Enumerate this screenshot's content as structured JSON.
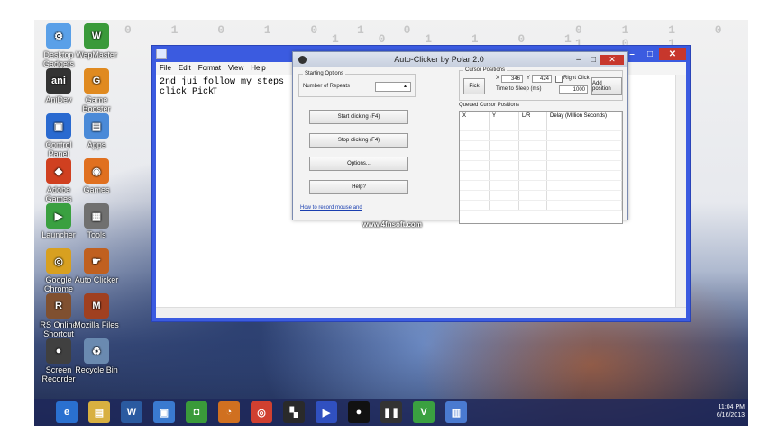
{
  "desktop": {
    "background_digits": [
      "0 1 0 1 0 1 0",
      "1 0 1 1 0 1",
      "0 1 1 0 1 0 1"
    ],
    "icons": [
      {
        "label": "Desktop Gadgets",
        "icon": "gadgets-icon",
        "color": "#5aa0e8",
        "glyph": "⚙"
      },
      {
        "label": "WapMaster",
        "icon": "w-app-icon",
        "color": "#3a9a3a",
        "glyph": "W"
      },
      {
        "label": "AniDev",
        "icon": "ani-icon",
        "color": "#333333",
        "glyph": "ani"
      },
      {
        "label": "Game Booster",
        "icon": "booster-icon",
        "color": "#e08a20",
        "glyph": "G"
      },
      {
        "label": "Control Panel",
        "icon": "control-panel-icon",
        "color": "#2a6ad0",
        "glyph": "▣"
      },
      {
        "label": "Apps",
        "icon": "apps-icon",
        "color": "#4a8ad8",
        "glyph": "▤"
      },
      {
        "label": "Adobe Games",
        "icon": "games-icon",
        "color": "#d04020",
        "glyph": "◆"
      },
      {
        "label": "Games",
        "icon": "games2-icon",
        "color": "#e07020",
        "glyph": "◉"
      },
      {
        "label": "Launcher",
        "icon": "launcher-icon",
        "color": "#3aa040",
        "glyph": "▶"
      },
      {
        "label": "Tools",
        "icon": "tools-icon",
        "color": "#707070",
        "glyph": "▦"
      },
      {
        "label": "Google Chrome",
        "icon": "chrome-icon",
        "color": "#d8a020",
        "glyph": "◎"
      },
      {
        "label": "Auto Clicker",
        "icon": "hand-icon",
        "color": "#c06020",
        "glyph": "☛"
      },
      {
        "label": "RS Online Shortcut",
        "icon": "rs-icon",
        "color": "#805030",
        "glyph": "R"
      },
      {
        "label": "Mozilla Files",
        "icon": "mozilla-icon",
        "color": "#a04020",
        "glyph": "M"
      },
      {
        "label": "Screen Recorder",
        "icon": "recorder-icon",
        "color": "#404040",
        "glyph": "●"
      },
      {
        "label": "Recycle Bin",
        "icon": "recycle-bin-icon",
        "color": "#6a8ab0",
        "glyph": "♻"
      }
    ]
  },
  "notepad": {
    "menu": [
      "File",
      "Edit",
      "Format",
      "View",
      "Help"
    ],
    "text": "2nd jui follow my steps\nclick Pick",
    "controls": {
      "minimize": "–",
      "maximize": "□",
      "close": "✕"
    }
  },
  "autoclicker": {
    "title": "Auto-Clicker by Polar 2.0",
    "controls": {
      "minimize": "–",
      "maximize": "□",
      "close": "✕"
    },
    "starting_options": {
      "caption": "Starting Options",
      "repeats_label": "Number of Repeats",
      "repeats_value": ""
    },
    "buttons": {
      "start": "Start clicking (F4)",
      "stop": "Stop clicking (F4)",
      "options": "Options...",
      "help": "Help?"
    },
    "record_link": "How to record mouse and",
    "cursor_positions": {
      "caption": "Cursor Positions",
      "pick": "Pick",
      "x_label": "X",
      "x_value": "346",
      "y_label": "Y",
      "y_value": "424",
      "right_click_label": "Right Click",
      "sleep_label": "Time to Sleep (ms)",
      "sleep_value": "1000",
      "add_position": "Add position"
    },
    "queued": {
      "caption": "Queued Cursor Positions",
      "columns": [
        "X",
        "Y",
        "L/R",
        "Delay (Million Seconds)"
      ]
    }
  },
  "watermark": "www.4fnsoft.com",
  "taskbar": {
    "apps": [
      {
        "name": "ie-icon",
        "color": "#2a70d0",
        "glyph": "e"
      },
      {
        "name": "file-explorer-icon",
        "color": "#d8b040",
        "glyph": "▤"
      },
      {
        "name": "word-icon",
        "color": "#2a5aa0",
        "glyph": "W"
      },
      {
        "name": "media-icon",
        "color": "#3a7ad0",
        "glyph": "▣"
      },
      {
        "name": "green-app-icon",
        "color": "#3a9a3a",
        "glyph": "◘"
      },
      {
        "name": "gauge-icon",
        "color": "#d07020",
        "glyph": "◔"
      },
      {
        "name": "chrome-taskbar-icon",
        "color": "#d04030",
        "glyph": "◎"
      },
      {
        "name": "game-icon",
        "color": "#2a2a2a",
        "glyph": "▚"
      },
      {
        "name": "video-icon",
        "color": "#3050c0",
        "glyph": "▶"
      },
      {
        "name": "recorder-taskbar-icon",
        "color": "#111111",
        "glyph": "●"
      },
      {
        "name": "pause-icon",
        "color": "#333333",
        "glyph": "❚❚"
      },
      {
        "name": "vuze-icon",
        "color": "#3aa040",
        "glyph": "V"
      },
      {
        "name": "notepad-taskbar-icon",
        "color": "#4a7ad0",
        "glyph": "▥"
      }
    ],
    "time": "11:04 PM",
    "date": "6/16/2013"
  }
}
